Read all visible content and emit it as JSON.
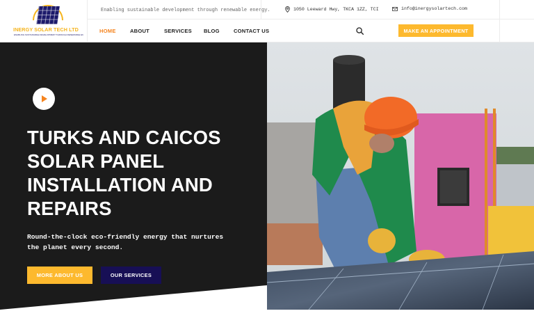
{
  "brand": {
    "name": "INERGY SOLAR TECH LTD",
    "tagline": "ENABLING SUSTAINABLE DEVELOPMENT THROUGH RENEWABLE ENERGY",
    "colors": {
      "accent": "#fdb92e",
      "orange": "#f5841f",
      "navy": "#170f55",
      "dark": "#1b1b1b"
    }
  },
  "topbar": {
    "tagline": "Enabling sustainable development through renewable energy.",
    "address": "1050 Leeward Hwy, TKCA 1ZZ, TCI",
    "email": "info@inergysolartech.com",
    "address_icon": "location-pin-icon",
    "email_icon": "envelope-icon"
  },
  "nav": {
    "items": [
      {
        "label": "HOME",
        "active": true
      },
      {
        "label": "ABOUT",
        "active": false
      },
      {
        "label": "SERVICES",
        "active": false
      },
      {
        "label": "BLOG",
        "active": false
      },
      {
        "label": "CONTACT US",
        "active": false
      }
    ],
    "search_icon": "search-icon",
    "cta": "MAKE AN APPOINTMENT"
  },
  "hero": {
    "title_lines": [
      "TURKS AND CAICOS",
      "SOLAR PANEL",
      "INSTALLATION AND",
      "REPAIRS"
    ],
    "subtitle_lines": [
      "Round-the-clock eco-friendly energy that nurtures",
      "the planet every second."
    ],
    "primary_button": "MORE ABOUT US",
    "secondary_button": "OUR SERVICES",
    "play_icon": "play-icon"
  }
}
